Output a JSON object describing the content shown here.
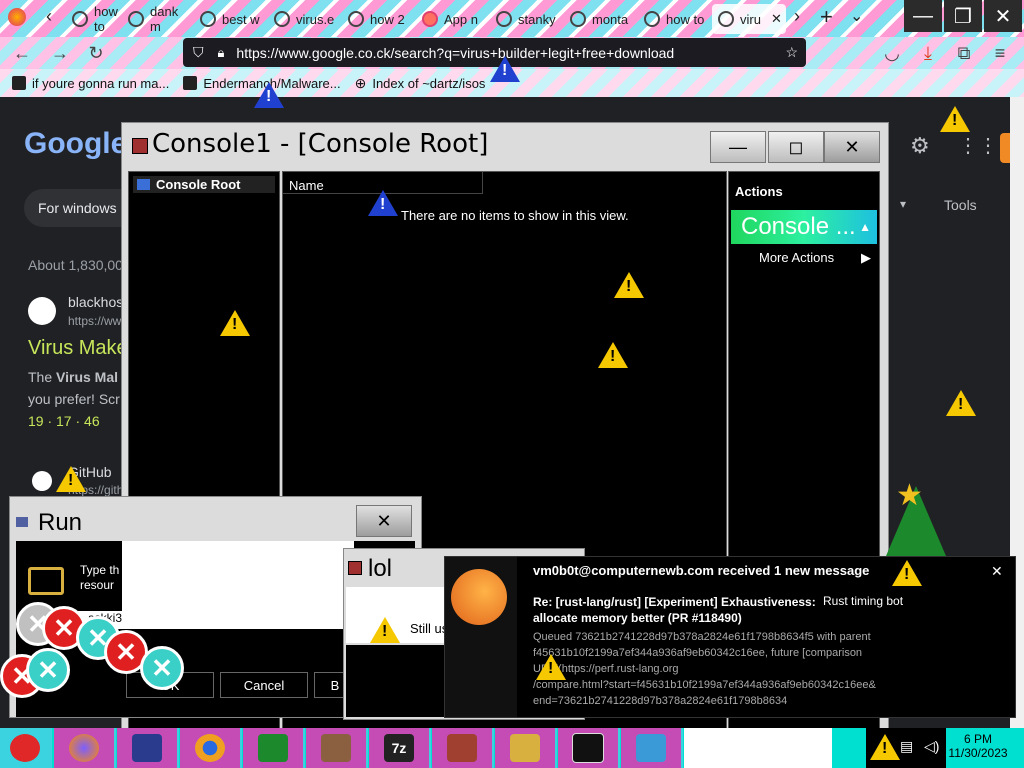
{
  "browser": {
    "tabs": [
      {
        "label": "how to"
      },
      {
        "label": "dank m"
      },
      {
        "label": "best w"
      },
      {
        "label": "virus.e"
      },
      {
        "label": "how 2"
      },
      {
        "label": "App n"
      },
      {
        "label": "stanky"
      },
      {
        "label": "monta"
      },
      {
        "label": "how to"
      },
      {
        "label": "viru"
      }
    ],
    "new_tab": "+",
    "url": "https://www.google.co.ck/search?q=virus+builder+legit+free+download",
    "bookmarks": [
      {
        "label": "if youre gonna run ma..."
      },
      {
        "label": "Endermanch/Malware..."
      },
      {
        "label": "Index of ~dartz/isos"
      }
    ]
  },
  "google": {
    "logo": "Google",
    "search_value": "For windows",
    "tools": "Tools",
    "results_count": "About 1,830,00",
    "result1_site": "blackhos",
    "result1_url": "https://ww",
    "result1_title": "Virus Make",
    "result1_snippet_bold": "Virus Mal",
    "result1_snippet_pre": "The ",
    "result1_snippet2": "you prefer! Scr",
    "result1_links": "19 · 17 · 46",
    "result2_site": "GitHub",
    "result2_url": "https://gith"
  },
  "console": {
    "title": "Console1 - [Console Root]",
    "tree_root": "Console Root",
    "column_name": "Name",
    "empty_msg": "There are no items to show in this view.",
    "actions_header": "Actions",
    "actions_item": "Console ...",
    "more_actions": "More Actions"
  },
  "run_dialog": {
    "title": "Run",
    "desc": "Type th resour",
    "input_value": "askki3",
    "ok": "OK",
    "cancel": "Cancel",
    "browse": "B"
  },
  "lol_dialog": {
    "title": "lol",
    "message": "Still us"
  },
  "notification": {
    "heading": "vm0b0t@computernewb.com received 1 new message",
    "subject": "Re: [rust-lang/rust] [Experiment] Exhaustiveness: allocate memory better (PR #118490)",
    "sender": "Rust timing bot",
    "body_lines": [
      "Queued 73621b2741228d97b378a2824e61f1798b8634f5 with parent",
      "f45631b10f2199a7ef344a936af9eb60342c16ee, future [comparison",
      "URL](https://perf.rust-lang.org",
      "/compare.html?start=f45631b10f2199a7ef344a936af9eb60342c16ee&",
      "end=73621b2741228d97b378a2824e61f1798b8634"
    ],
    "close": "✕"
  },
  "taskbar": {
    "clock_time": "6 PM",
    "clock_date": "11/30/2023",
    "tray_icon_names": [
      "warning-icon",
      "network-icon",
      "volume-icon"
    ],
    "apps": [
      "santa-icon",
      "firefox-icon",
      "piano-icon",
      "chrome-icon",
      "tree-icon",
      "bricks-icon",
      "7zip-icon",
      "radio-icon",
      "drive-icon",
      "terminal-icon",
      "toolbox-icon"
    ],
    "app_7z_label": "7z"
  },
  "colors": {
    "google_bg": "#202124",
    "result_link": "#c7e65a",
    "taskbar_bg": "#00e0d0",
    "taskbar_btn": "#c44cb4",
    "console_actions_gradient": "#1fd65d"
  }
}
